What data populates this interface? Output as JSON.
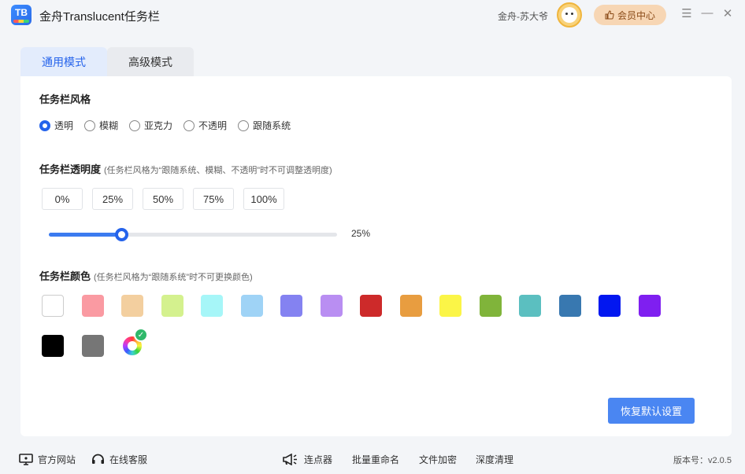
{
  "app": {
    "logo_text": "TB",
    "title": "金舟Translucent任务栏"
  },
  "user": {
    "name": "金舟-苏大爷",
    "vip_label": "会员中心"
  },
  "window_controls": {
    "menu": "☰",
    "minimize": "—",
    "close": "✕"
  },
  "tabs": [
    {
      "label": "通用模式",
      "active": true
    },
    {
      "label": "高级模式",
      "active": false
    }
  ],
  "style_section": {
    "title": "任务栏风格",
    "options": [
      {
        "label": "透明",
        "checked": true
      },
      {
        "label": "模糊",
        "checked": false
      },
      {
        "label": "亚克力",
        "checked": false
      },
      {
        "label": "不透明",
        "checked": false
      },
      {
        "label": "跟随系统",
        "checked": false
      }
    ]
  },
  "opacity_section": {
    "title": "任务栏透明度",
    "note": "(任务栏风格为“跟随系统、模糊、不透明”时不可调整透明度)",
    "presets": [
      "0%",
      "25%",
      "50%",
      "75%",
      "100%"
    ],
    "slider_fraction": 0.25,
    "value_label": "25%"
  },
  "color_section": {
    "title": "任务栏颜色",
    "note": "(任务栏风格为“跟随系统”时不可更换颜色)",
    "colors": [
      "#ffffff",
      "#fa9aa2",
      "#f3cf9f",
      "#d4f18e",
      "#a6f6f8",
      "#9fd3f6",
      "#8482f1",
      "#b98ef2",
      "#cd2a2a",
      "#e89d40",
      "#fbf547",
      "#80b43a",
      "#5bbfc0",
      "#3878b0",
      "#0217f0",
      "#7f1ff0",
      "#000000",
      "#767676"
    ],
    "selected": "color-picker"
  },
  "reset_label": "恢复默认设置",
  "footer": {
    "website": "官方网站",
    "support": "在线客服",
    "clicker": "连点器",
    "rename": "批量重命名",
    "encrypt": "文件加密",
    "clean": "深度清理",
    "version": "版本号：v2.0.5"
  }
}
